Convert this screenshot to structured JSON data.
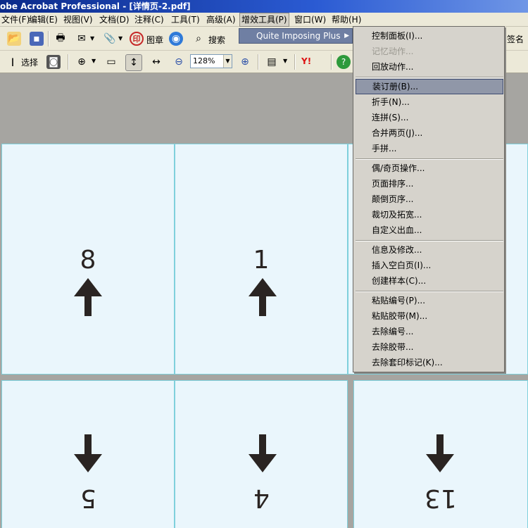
{
  "window": {
    "title": "obe Acrobat Professional - [详情页-2.pdf]"
  },
  "menubar": [
    {
      "label": "文件(F)"
    },
    {
      "label": "编辑(E)"
    },
    {
      "label": "视图(V)"
    },
    {
      "label": "文档(D)"
    },
    {
      "label": "注释(C)"
    },
    {
      "label": "工具(T)"
    },
    {
      "label": "高级(A)"
    },
    {
      "label": "增效工具(P)"
    },
    {
      "label": "窗口(W)"
    },
    {
      "label": "帮助(H)"
    }
  ],
  "toolbar1": {
    "stamp_label": "图章",
    "search_label": "搜索",
    "sign_label": "签名"
  },
  "toolbar2": {
    "select_label": "选择",
    "zoom_value": "128%"
  },
  "submenu": {
    "label": "Quite Imposing Plus"
  },
  "dropdown": {
    "groups": [
      [
        {
          "label": "控制面板(I)...",
          "disabled": false
        },
        {
          "label": "记忆动作...",
          "disabled": true
        },
        {
          "label": "回放动作...",
          "disabled": false
        }
      ],
      [
        {
          "label": "装订册(B)...",
          "highlight": true
        },
        {
          "label": "折手(N)..."
        },
        {
          "label": "连拼(S)..."
        },
        {
          "label": "合并两页(J)..."
        },
        {
          "label": "手拼..."
        }
      ],
      [
        {
          "label": "偶/奇页操作..."
        },
        {
          "label": "页面排序..."
        },
        {
          "label": "颠倒页序..."
        },
        {
          "label": "裁切及拓宽..."
        },
        {
          "label": "自定义出血..."
        }
      ],
      [
        {
          "label": "信息及修改..."
        },
        {
          "label": "插入空白页(I)..."
        },
        {
          "label": "创建样本(C)..."
        }
      ],
      [
        {
          "label": "粘贴编号(P)..."
        },
        {
          "label": "粘贴胶带(M)..."
        },
        {
          "label": "去除编号..."
        },
        {
          "label": "去除胶带..."
        },
        {
          "label": "去除套印标记(K)..."
        }
      ]
    ]
  },
  "pages": {
    "top": [
      "8",
      "1"
    ],
    "bottom": [
      "5",
      "4",
      "13"
    ]
  }
}
